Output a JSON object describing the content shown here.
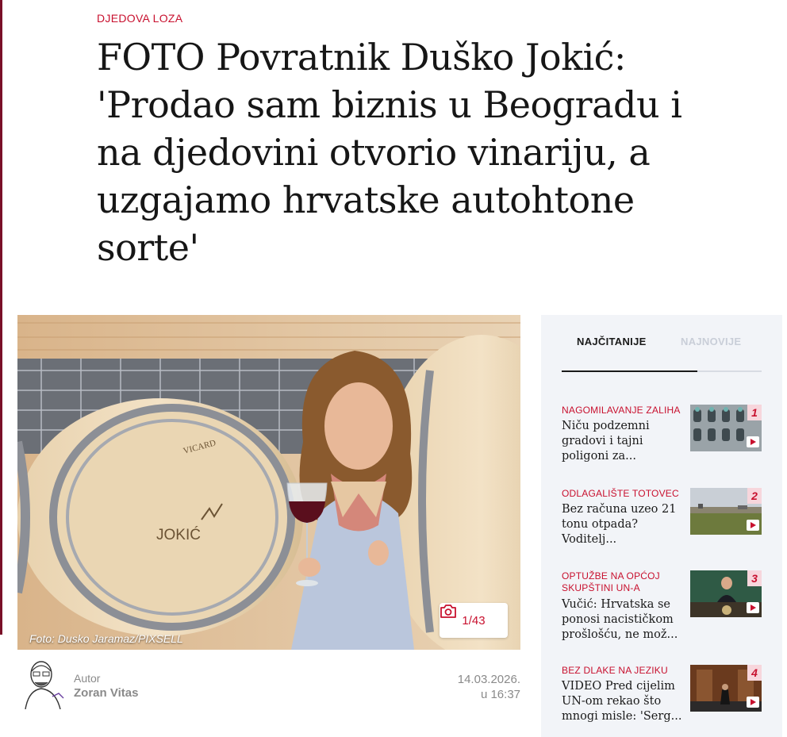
{
  "article": {
    "kicker": "DJEDOVA LOZA",
    "title": "FOTO Povratnik Duško Jokić: 'Prodao sam biznis u Beogradu i na djedovini otvorio vinariju, a uzgajamo hrvatske autohtone sorte'",
    "photo_credit": "Foto: Dusko Jaramaz/PIXSELL",
    "gallery_count": "1/43",
    "barrel_brand": "JOKIĆ",
    "barrel_maker": "VICARD"
  },
  "author": {
    "label": "Autor",
    "name": "Zoran Vitas",
    "date": "14.03.2026.",
    "time": "u 16:37"
  },
  "sidebar": {
    "tabs": [
      "NAJČITANIJE",
      "NAJNOVIJE"
    ],
    "active_tab": "NAJČITANIJE",
    "items": [
      {
        "rank": "1",
        "category": "NAGOMILAVANJE ZALIHA",
        "title": "Niču podzemni gradovi i tajni poligoni za..."
      },
      {
        "rank": "2",
        "category": "ODLAGALIŠTE TOTOVEC",
        "title": "Bez računa uzeo 21 tonu otpada? Voditelj..."
      },
      {
        "rank": "3",
        "category": "OPTUŽBE NA OPĆOJ SKUPŠTINI UN-A",
        "title": "Vučić: Hrvatska se ponosi nacističkom prošlošću, ne mož..."
      },
      {
        "rank": "4",
        "category": "BEZ DLAKE NA JEZIKU",
        "title": "VIDEO Pred cijelim UN-om rekao što mnogi misle: 'Serg..."
      }
    ]
  },
  "colors": {
    "accent": "#c8102e",
    "sidebar_bg": "#f2f4f8"
  }
}
